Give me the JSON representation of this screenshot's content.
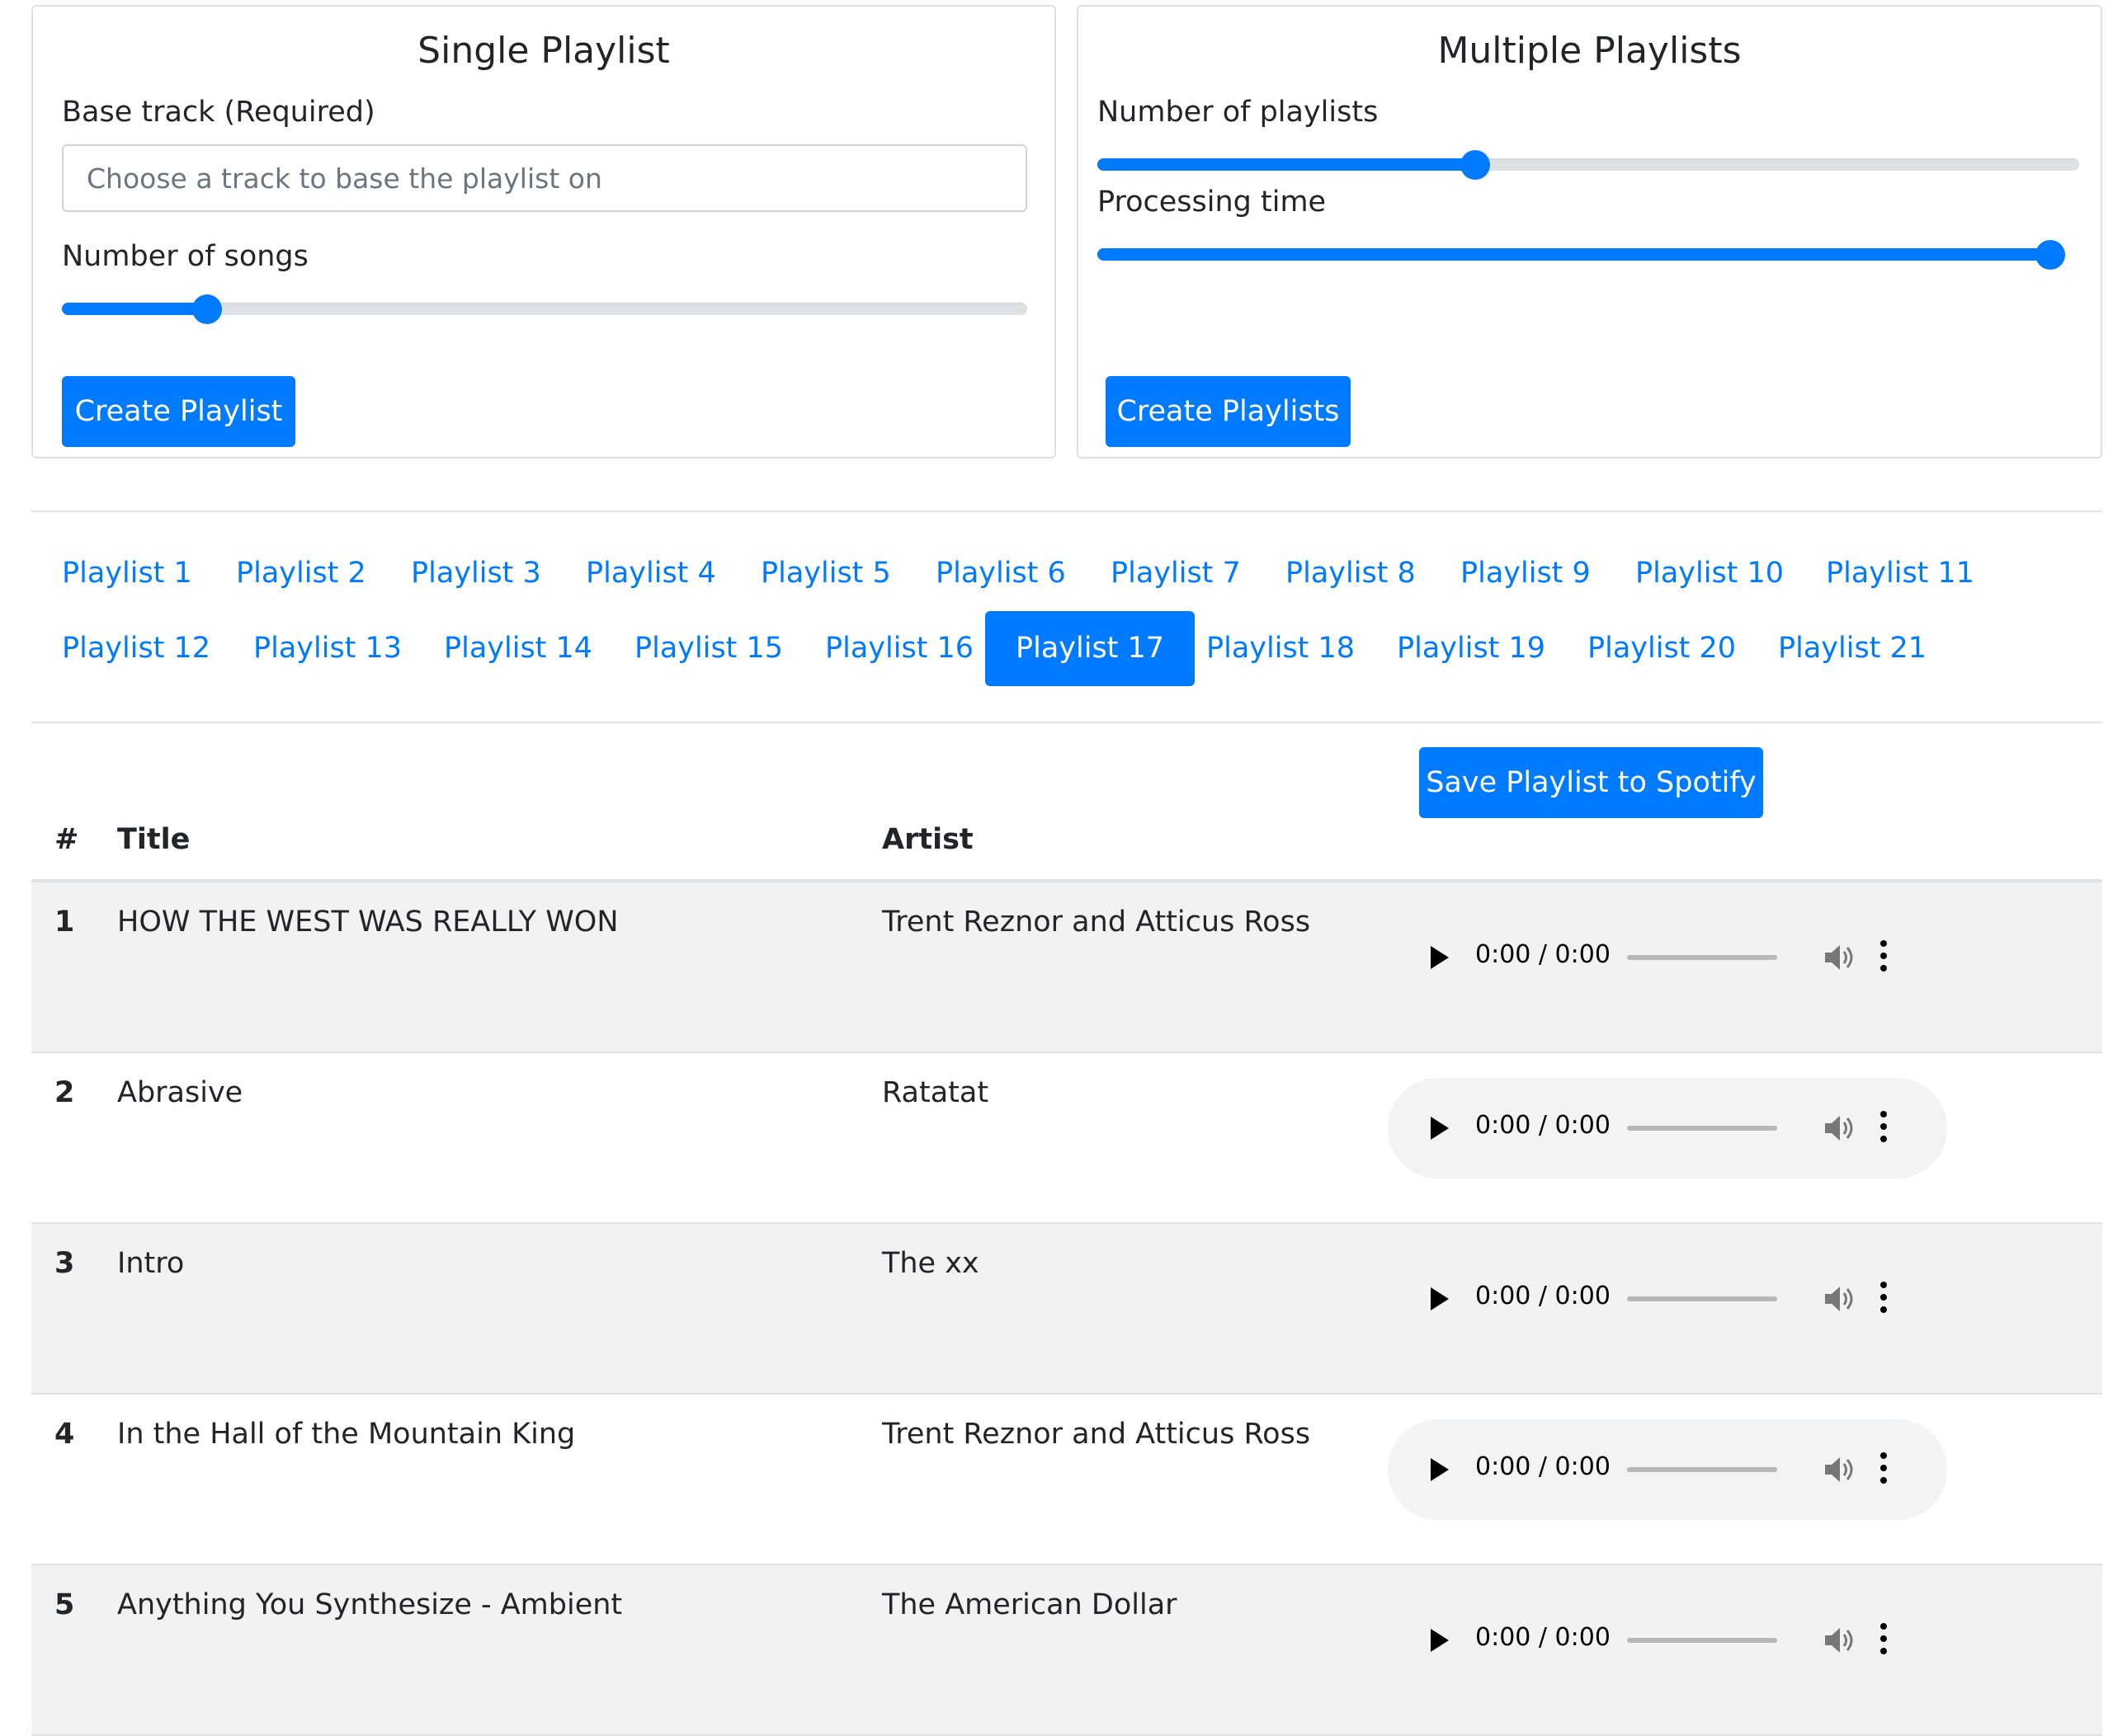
{
  "single": {
    "title": "Single Playlist",
    "base_track_label": "Base track (Required)",
    "base_track_placeholder": "Choose a track to base the playlist on",
    "base_track_value": "",
    "num_songs_label": "Number of songs",
    "num_songs_fraction": 0.15,
    "create_button": "Create Playlist"
  },
  "multi": {
    "title": "Multiple Playlists",
    "num_playlists_label": "Number of playlists",
    "num_playlists_fraction": 0.385,
    "processing_time_label": "Processing time",
    "processing_time_fraction": 1.0,
    "create_button": "Create Playlists"
  },
  "tabs": {
    "items": [
      "Playlist 1",
      "Playlist 2",
      "Playlist 3",
      "Playlist 4",
      "Playlist 5",
      "Playlist 6",
      "Playlist 7",
      "Playlist 8",
      "Playlist 9",
      "Playlist 10",
      "Playlist 11",
      "Playlist 12",
      "Playlist 13",
      "Playlist 14",
      "Playlist 15",
      "Playlist 16",
      "Playlist 17",
      "Playlist 18",
      "Playlist 19",
      "Playlist 20",
      "Playlist 21"
    ],
    "active": "Playlist 17"
  },
  "table": {
    "save_button": "Save Playlist to Spotify",
    "headers": {
      "num": "#",
      "title": "Title",
      "artist": "Artist"
    },
    "rows": [
      {
        "num": "1",
        "title": "HOW THE WEST WAS REALLY WON",
        "artist": "Trent Reznor and Atticus Ross",
        "time": "0:00 / 0:00"
      },
      {
        "num": "2",
        "title": "Abrasive",
        "artist": "Ratatat",
        "time": "0:00 / 0:00"
      },
      {
        "num": "3",
        "title": "Intro",
        "artist": "The xx",
        "time": "0:00 / 0:00"
      },
      {
        "num": "4",
        "title": "In the Hall of the Mountain King",
        "artist": "Trent Reznor and Atticus Ross",
        "time": "0:00 / 0:00"
      },
      {
        "num": "5",
        "title": "Anything You Synthesize - Ambient",
        "artist": "The American Dollar",
        "time": "0:00 / 0:00"
      }
    ]
  },
  "icons": {
    "play": "play-icon",
    "volume": "volume-icon",
    "more": "more-options-icon"
  },
  "colors": {
    "primary": "#007bff",
    "stripe": "#f2f2f2",
    "player": "#f1f3f4"
  }
}
